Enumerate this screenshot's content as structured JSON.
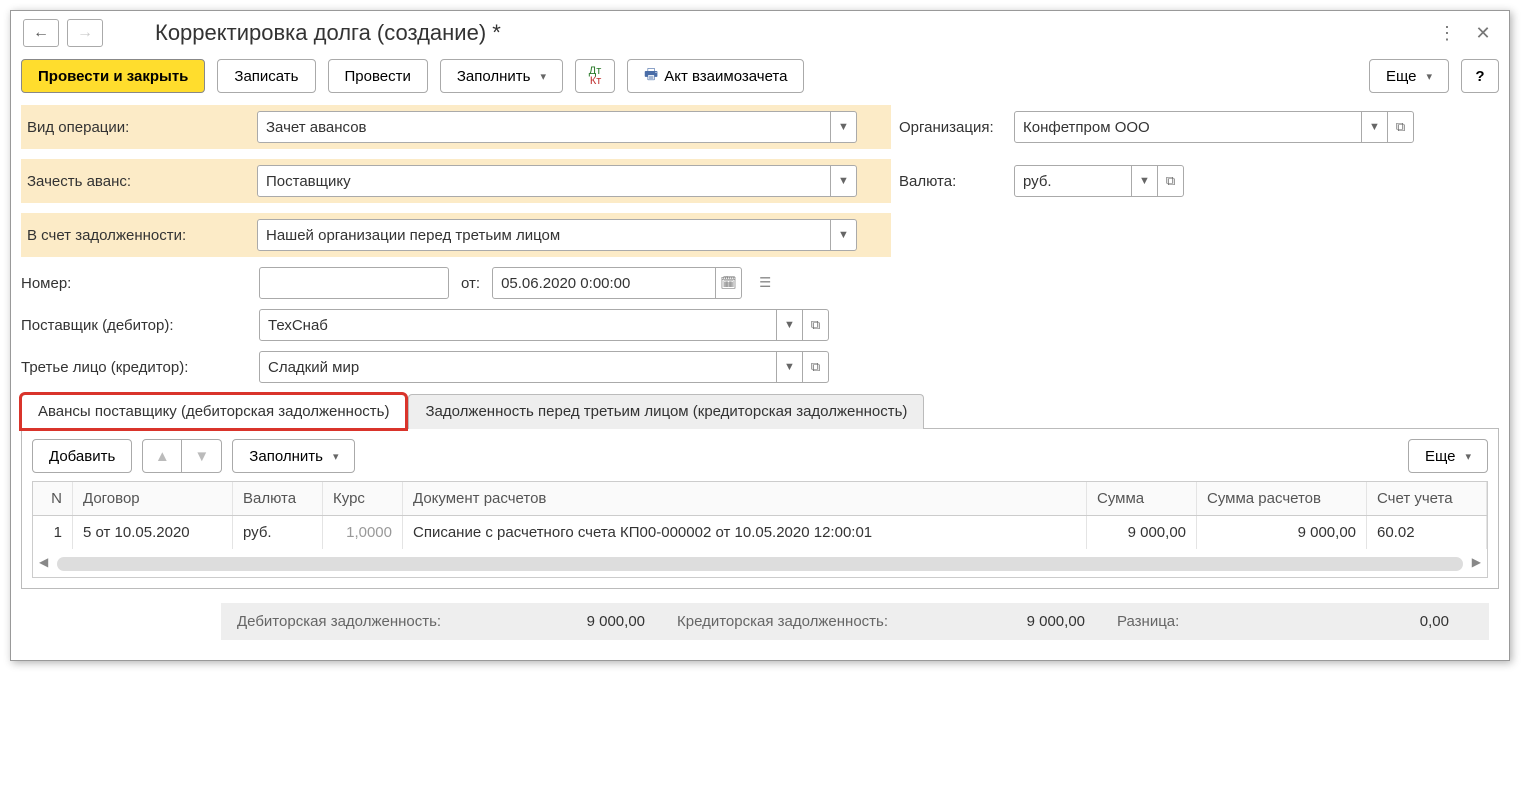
{
  "header": {
    "title": "Корректировка долга (создание) *"
  },
  "toolbar": {
    "post_close": "Провести и закрыть",
    "save": "Записать",
    "post": "Провести",
    "fill": "Заполнить",
    "offset_act": "Акт взаимозачета",
    "more": "Еще",
    "help": "?"
  },
  "fields": {
    "operation_type_label": "Вид операции:",
    "operation_type_value": "Зачет авансов",
    "advance_label": "Зачесть аванс:",
    "advance_value": "Поставщику",
    "debt_to_label": "В счет задолженности:",
    "debt_to_value": "Нашей организации перед третьим лицом",
    "number_label": "Номер:",
    "number_value": "",
    "date_prefix": "от:",
    "date_value": "05.06.2020  0:00:00",
    "org_label": "Организация:",
    "org_value": "Конфетпром ООО",
    "currency_label": "Валюта:",
    "currency_value": "руб.",
    "supplier_label": "Поставщик (дебитор):",
    "supplier_value": "ТехСнаб",
    "third_party_label": "Третье лицо (кредитор):",
    "third_party_value": "Сладкий мир"
  },
  "tabs": {
    "tab1": "Авансы поставщику (дебиторская задолженность)",
    "tab2": "Задолженность перед третьим лицом (кредиторская задолженность)"
  },
  "tab_toolbar": {
    "add": "Добавить",
    "fill": "Заполнить",
    "more": "Еще"
  },
  "table": {
    "cols": {
      "n": "N",
      "contract": "Договор",
      "currency": "Валюта",
      "rate": "Курс",
      "doc": "Документ расчетов",
      "sum": "Сумма",
      "sumcalc": "Сумма расчетов",
      "acct": "Счет учета"
    },
    "rows": [
      {
        "n": "1",
        "contract": "5 от 10.05.2020",
        "currency": "руб.",
        "rate": "1,0000",
        "doc": "Списание с расчетного счета КП00-000002 от 10.05.2020 12:00:01",
        "sum": "9 000,00",
        "sumcalc": "9 000,00",
        "acct": "60.02"
      }
    ]
  },
  "footer": {
    "deb_label": "Дебиторская задолженность:",
    "deb_value": "9 000,00",
    "cred_label": "Кредиторская задолженность:",
    "cred_value": "9 000,00",
    "diff_label": "Разница:",
    "diff_value": "0,00"
  }
}
